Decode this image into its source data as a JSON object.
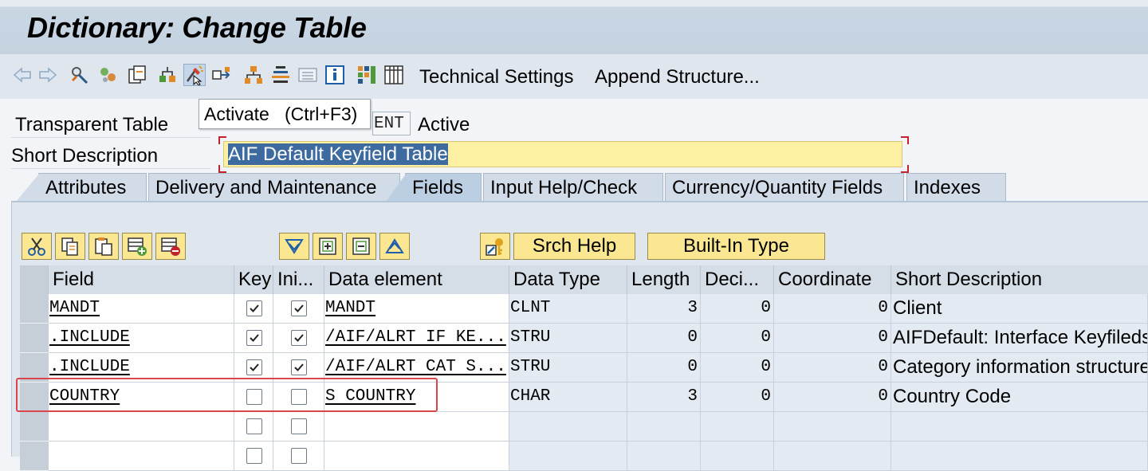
{
  "window": {
    "title": "Dictionary: Change Table"
  },
  "toolbar": {
    "icons": [
      "back-arrow-icon",
      "forward-arrow-icon",
      "display-change-icon",
      "other-object-icon",
      "copy-object-icon",
      "check-icon",
      "activate-icon",
      "test-icon",
      "where-used-icon",
      "hierarchy-icon",
      "list-icon",
      "info-icon",
      "color-grid-icon",
      "columns-icon"
    ],
    "technical_settings": "Technical Settings",
    "append_structure": "Append Structure..."
  },
  "tooltip": {
    "text": "Activate   (Ctrl+F3)"
  },
  "header": {
    "table_type_label": "Transparent Table",
    "table_name_suffix": "ENT",
    "status": "Active",
    "short_description_label": "Short Description",
    "short_description_value": "AIF Default Keyfield Table"
  },
  "tabs": [
    {
      "label": "Attributes",
      "active": false
    },
    {
      "label": "Delivery and Maintenance",
      "active": false
    },
    {
      "label": "Fields",
      "active": true
    },
    {
      "label": "Input Help/Check",
      "active": false
    },
    {
      "label": "Currency/Quantity Fields",
      "active": false
    },
    {
      "label": "Indexes",
      "active": false
    }
  ],
  "table_toolbar": {
    "icons": [
      "cut-icon",
      "copy-icon",
      "paste-icon",
      "insert-row-icon",
      "delete-row-icon",
      "sort-descending-icon",
      "expand-icon",
      "collapse-icon",
      "sort-ascending-icon",
      "key-icon"
    ],
    "srch_help": "Srch Help",
    "built_in_type": "Built-In Type"
  },
  "columns": {
    "field": "Field",
    "key": "Key",
    "initial": "Ini...",
    "data_element": "Data element",
    "data_type": "Data Type",
    "length": "Length",
    "decimals": "Deci...",
    "coordinate": "Coordinate",
    "short_description": "Short Description"
  },
  "rows": [
    {
      "field": "MANDT",
      "key": true,
      "initial": true,
      "data_element": "MANDT",
      "data_type": "CLNT",
      "length": "3",
      "decimals": "0",
      "coordinate": "0",
      "short_description": "Client"
    },
    {
      "field": ".INCLUDE",
      "key": true,
      "initial": true,
      "data_element": "/AIF/ALRT IF KE...",
      "data_type": "STRU",
      "length": "0",
      "decimals": "0",
      "coordinate": "0",
      "short_description": "AIFDefault: Interface Keyfileds"
    },
    {
      "field": ".INCLUDE",
      "key": true,
      "initial": true,
      "data_element": "/AIF/ALRT CAT S...",
      "data_type": "STRU",
      "length": "0",
      "decimals": "0",
      "coordinate": "0",
      "short_description": "Category information structure"
    },
    {
      "field": "COUNTRY",
      "key": false,
      "initial": false,
      "data_element": "S COUNTRY",
      "data_type": "CHAR",
      "length": "3",
      "decimals": "0",
      "coordinate": "0",
      "short_description": "Country Code"
    },
    {
      "field": "",
      "key": false,
      "initial": false,
      "data_element": "",
      "data_type": "",
      "length": "",
      "decimals": "",
      "coordinate": "",
      "short_description": ""
    },
    {
      "field": "",
      "key": false,
      "initial": false,
      "data_element": "",
      "data_type": "",
      "length": "",
      "decimals": "",
      "coordinate": "",
      "short_description": ""
    }
  ],
  "colors": {
    "accent": "#3d6b9f",
    "input_highlight": "#fdf0a2",
    "annotation_red": "#d9464b"
  }
}
